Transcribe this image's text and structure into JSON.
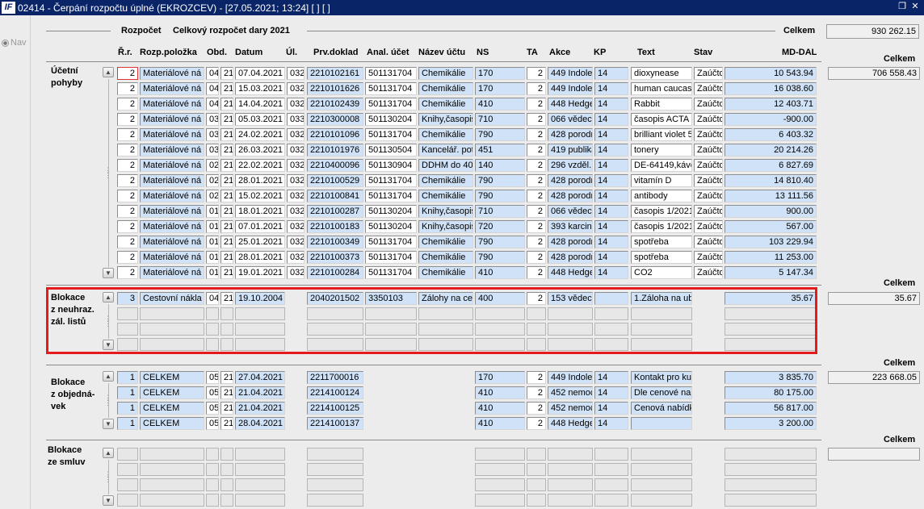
{
  "window": {
    "title": "02414 - Čerpání rozpočtu úplné (EKROZCEV) - [27.05.2021; 13:24] [ ] [ ]",
    "app_icon": "IF",
    "restore_icon": "restore-icon",
    "close_icon": "close-icon"
  },
  "nav": {
    "label": "Nav"
  },
  "header": {
    "rozpocet_label": "Rozpočet",
    "rozpocet_value": "Celkový rozpočet dary 2021",
    "celkem_label": "Celkem",
    "celkem_value": "930 262.15"
  },
  "columns": [
    "Ř.r.",
    "Rozp.položka",
    "Obd.",
    "Datum",
    "Úl.",
    "Prv.doklad",
    "Anal. účet",
    "Název účtu",
    "NS",
    "TA",
    "Akce",
    "KP",
    "Text",
    "Stav",
    "MD-DAL"
  ],
  "sections": {
    "ucetni": {
      "label": "Účetní pohyby",
      "celkem_label": "Celkem",
      "celkem_value": "706 558.43",
      "rows": [
        [
          "2",
          "Materiálové ná",
          "04",
          "21",
          "07.04.2021",
          "032",
          "2210102161",
          "501131704",
          "Chemikálie",
          "170",
          "2",
          "449 Indolea",
          "14",
          "dioxynease",
          "Zaúčto",
          "10 543.94"
        ],
        [
          "2",
          "Materiálové ná",
          "04",
          "21",
          "15.03.2021",
          "032",
          "2210101626",
          "501131704",
          "Chemikálie",
          "170",
          "2",
          "449 Indolea",
          "14",
          "human caucasi",
          "Zaúčto",
          "16 038.60"
        ],
        [
          "2",
          "Materiálové ná",
          "04",
          "21",
          "14.04.2021",
          "032",
          "2210102439",
          "501131704",
          "Chemikálie",
          "410",
          "2",
          "448 Hedge",
          "14",
          "Rabbit",
          "Zaúčto",
          "12 403.71"
        ],
        [
          "2",
          "Materiálové ná",
          "03",
          "21",
          "05.03.2021",
          "033",
          "2210300008",
          "501130204",
          "Knihy,časopis",
          "710",
          "2",
          "066 vědec",
          "14",
          "časopis ACTA",
          "Zaúčto",
          "-900.00"
        ],
        [
          "2",
          "Materiálové ná",
          "03",
          "21",
          "24.02.2021",
          "032",
          "2210101096",
          "501131704",
          "Chemikálie",
          "790",
          "2",
          "428 porodn",
          "14",
          "brilliant violet 5",
          "Zaúčto",
          "6 403.32"
        ],
        [
          "2",
          "Materiálové ná",
          "03",
          "21",
          "26.03.2021",
          "032",
          "2210101976",
          "501130504",
          "Kancelář. pot",
          "451",
          "2",
          "419 publika",
          "14",
          "tonery",
          "Zaúčto",
          "20 214.26"
        ],
        [
          "2",
          "Materiálové ná",
          "02",
          "21",
          "22.02.2021",
          "032",
          "2210400096",
          "501130904",
          "DDHM do 400",
          "140",
          "2",
          "296 vzděl.,",
          "14",
          "DE-64149,kávo",
          "Zaúčto",
          "6 827.69"
        ],
        [
          "2",
          "Materiálové ná",
          "02",
          "21",
          "28.01.2021",
          "032",
          "2210100529",
          "501131704",
          "Chemikálie",
          "790",
          "2",
          "428 porodn",
          "14",
          "vitamín D",
          "Zaúčto",
          "14 810.40"
        ],
        [
          "2",
          "Materiálové ná",
          "02",
          "21",
          "15.02.2021",
          "032",
          "2210100841",
          "501131704",
          "Chemikálie",
          "790",
          "2",
          "428 porodn",
          "14",
          "antibody",
          "Zaúčto",
          "13 111.56"
        ],
        [
          "2",
          "Materiálové ná",
          "01",
          "21",
          "18.01.2021",
          "032",
          "2210100287",
          "501130204",
          "Knihy,časopis",
          "710",
          "2",
          "066 vědec",
          "14",
          "časopis 1/2021",
          "Zaúčto",
          "900.00"
        ],
        [
          "2",
          "Materiálové ná",
          "01",
          "21",
          "07.01.2021",
          "032",
          "2210100183",
          "501130204",
          "Knihy,časopis",
          "720",
          "2",
          "393 karcino",
          "14",
          "časopis 1/2021",
          "Zaúčto",
          "567.00"
        ],
        [
          "2",
          "Materiálové ná",
          "01",
          "21",
          "25.01.2021",
          "032",
          "2210100349",
          "501131704",
          "Chemikálie",
          "790",
          "2",
          "428 porodn",
          "14",
          "spotřeba",
          "Zaúčto",
          "103 229.94"
        ],
        [
          "2",
          "Materiálové ná",
          "01",
          "21",
          "28.01.2021",
          "032",
          "2210100373",
          "501131704",
          "Chemikálie",
          "790",
          "2",
          "428 porodn",
          "14",
          "spotřeba",
          "Zaúčto",
          "11 253.00"
        ],
        [
          "2",
          "Materiálové ná",
          "01",
          "21",
          "19.01.2021",
          "032",
          "2210100284",
          "501131704",
          "Chemikálie",
          "410",
          "2",
          "448 Hedge",
          "14",
          "CO2",
          "Zaúčto",
          "5 147.34"
        ]
      ]
    },
    "zal": {
      "label_lines": [
        "Blokace",
        "z neuhraz.",
        "zál. listů"
      ],
      "celkem_label": "Celkem",
      "celkem_value": "35.67",
      "rows": [
        [
          "3",
          "Cestovní nákla",
          "04",
          "21",
          "19.10.2004",
          "",
          "2040201502",
          "3350103",
          "Zálohy na ce",
          "400",
          "2",
          "153 vědec",
          "",
          "1.Záloha na ub",
          "",
          "35.67"
        ]
      ]
    },
    "obj": {
      "label_lines": [
        "Blokace",
        "z objedná-",
        "vek"
      ],
      "celkem_label": "Celkem",
      "celkem_value": "223 668.05",
      "rows": [
        [
          "1",
          "CELKEM",
          "05",
          "21",
          "27.04.2021",
          "",
          "2211700016",
          "",
          "",
          "170",
          "2",
          "449 Indolea",
          "14",
          "Kontakt pro kur",
          "",
          "3 835.70"
        ],
        [
          "1",
          "CELKEM",
          "05",
          "21",
          "21.04.2021",
          "",
          "2214100124",
          "",
          "",
          "410",
          "2",
          "452 nemoc",
          "14",
          "Dle cenové nab",
          "",
          "80 175.00"
        ],
        [
          "1",
          "CELKEM",
          "05",
          "21",
          "21.04.2021",
          "",
          "2214100125",
          "",
          "",
          "410",
          "2",
          "452 nemoc",
          "14",
          "Cenová nabídka",
          "",
          "56 817.00"
        ],
        [
          "1",
          "CELKEM",
          "05",
          "21",
          "28.04.2021",
          "",
          "2214100137",
          "",
          "",
          "410",
          "2",
          "448 Hedge",
          "14",
          "",
          "",
          "3 200.00"
        ]
      ]
    },
    "smluv": {
      "label_lines": [
        "Blokace",
        "ze smluv"
      ],
      "celkem_label": "Celkem",
      "celkem_value": ""
    }
  },
  "icons": {
    "scroll_up": "▲",
    "scroll_down": "▼",
    "grip": "⋮"
  }
}
